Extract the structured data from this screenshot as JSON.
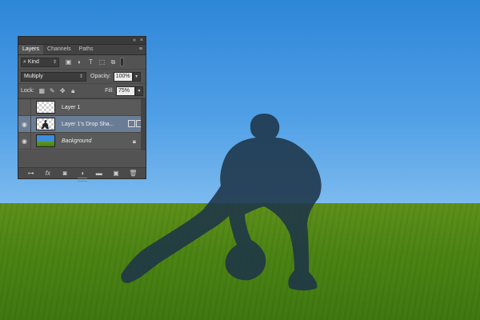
{
  "panel": {
    "titlebar": {
      "collapse_icon": "«",
      "close_icon": "×"
    },
    "tabs": [
      {
        "label": "Layers",
        "active": true
      },
      {
        "label": "Channels",
        "active": false
      },
      {
        "label": "Paths",
        "active": false
      }
    ],
    "filter": {
      "kind_label": "Kind",
      "icons": [
        "image-filter-icon",
        "adjustment-filter-icon",
        "type-filter-icon",
        "shape-filter-icon",
        "smart-object-filter-icon"
      ]
    },
    "blend": {
      "mode": "Multiply",
      "opacity_label": "Opacity:",
      "opacity_value": "100%"
    },
    "lock": {
      "label": "Lock:",
      "fill_label": "Fill:",
      "fill_value": "75%"
    },
    "layers": [
      {
        "name": "Layer 1",
        "visible": false,
        "selected": false,
        "thumb": "checker"
      },
      {
        "name": "Layer 1's Drop Sha...",
        "visible": true,
        "selected": true,
        "thumb": "checker-silhouette"
      },
      {
        "name": "Background",
        "visible": true,
        "selected": false,
        "thumb": "background",
        "locked": true
      }
    ],
    "bottom_icons": [
      "link-icon",
      "fx-icon",
      "mask-icon",
      "adjustment-icon",
      "folder-icon",
      "new-layer-icon",
      "trash-icon"
    ]
  },
  "colors": {
    "panel_bg": "#535353",
    "selected_layer": "#6a7d96",
    "sky": "#4f9fe6",
    "grass": "#4d8514",
    "silhouette": "#1f3a52"
  }
}
